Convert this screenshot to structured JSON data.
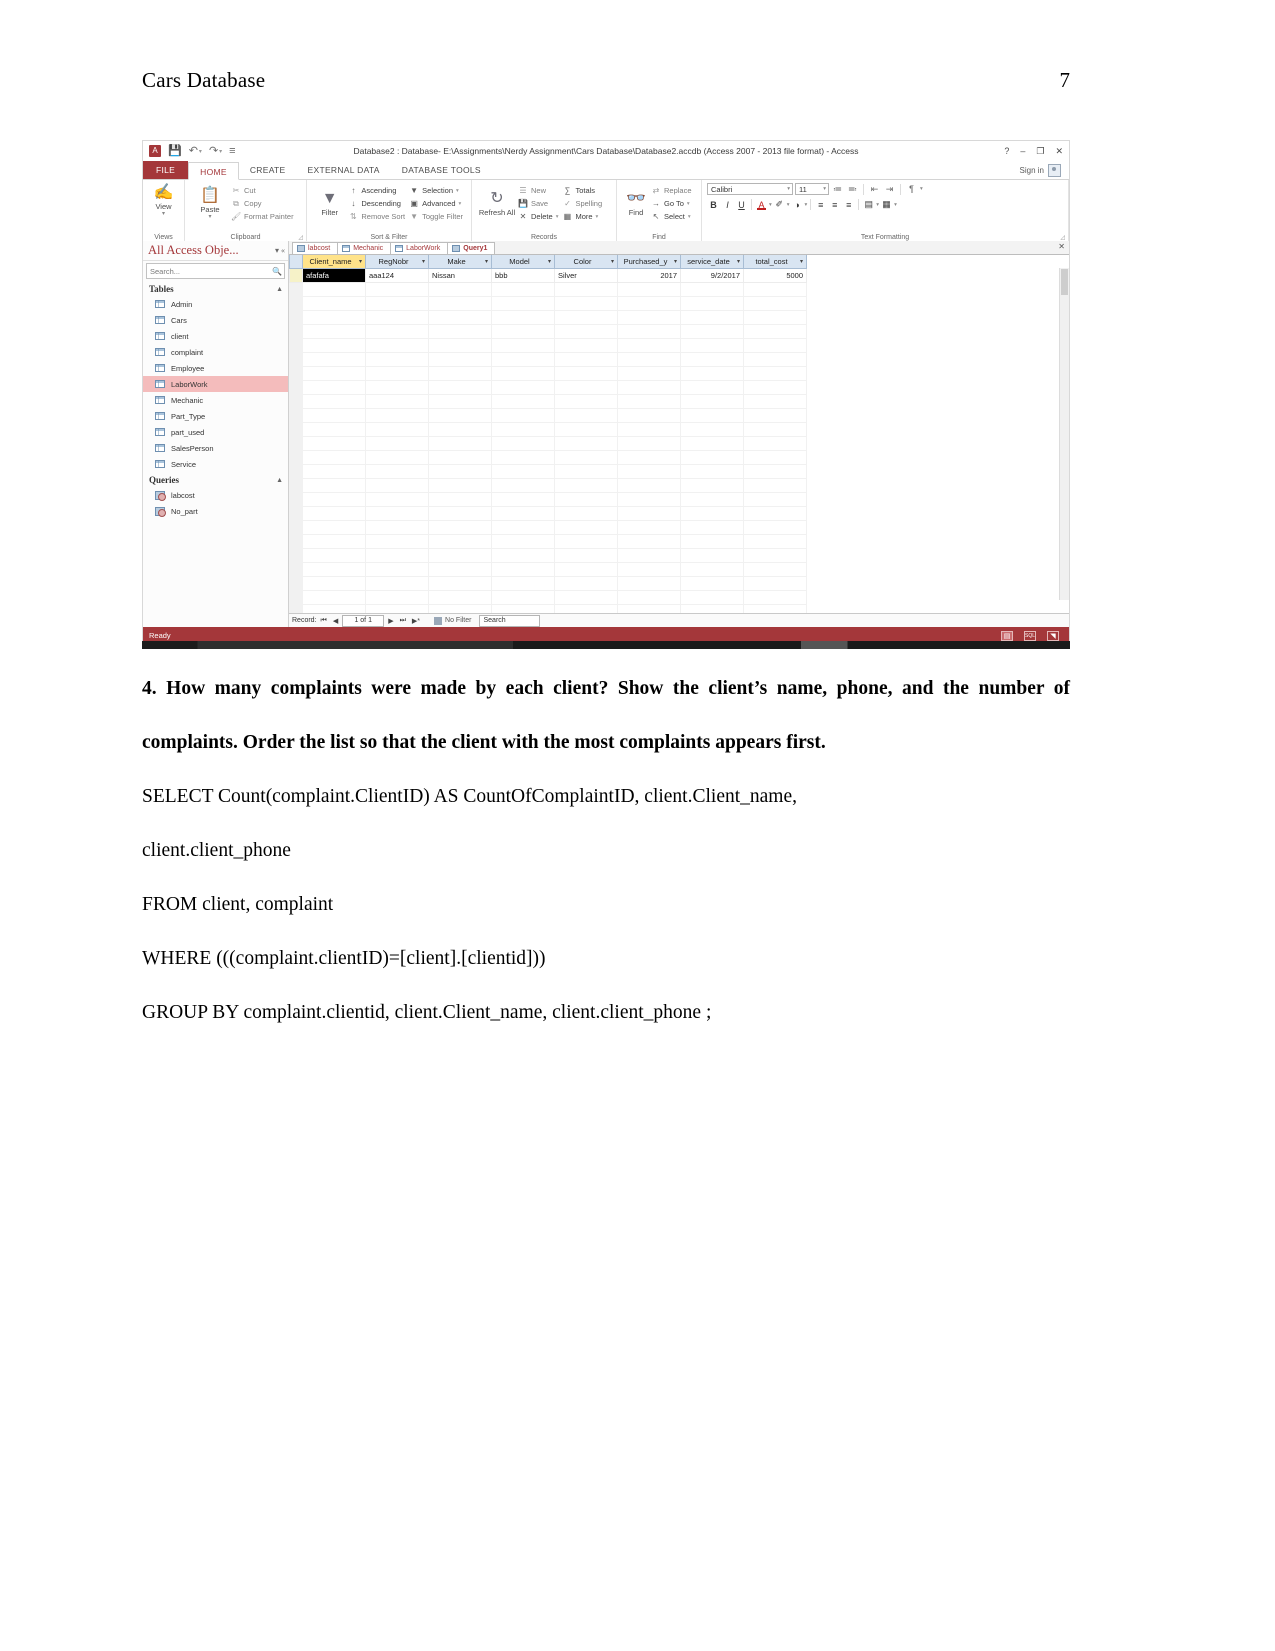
{
  "document": {
    "running_head": "Cars Database",
    "page_number": "7",
    "question": "4. How many complaints were made by each client? Show the client’s name, phone, and the number of complaints. Order the list so that the client with the most complaints appears first.",
    "sql_lines": [
      "SELECT Count(complaint.ClientID) AS CountOfComplaintID, client.Client_name,",
      "client.client_phone",
      "FROM client, complaint",
      "WHERE (((complaint.clientID)=[client].[clientid]))",
      "GROUP BY complaint.clientid, client.Client_name, client.client_phone ;"
    ]
  },
  "screenshot": {
    "titlebar": {
      "app_badge": "A",
      "window_title": "Database2 : Database- E:\\Assignments\\Nerdy Assignment\\Cars Database\\Database2.accdb (Access 2007 - 2013 file format) - Access",
      "qat": [
        {
          "name": "save-icon",
          "glyph": "💾"
        },
        {
          "name": "undo-icon",
          "glyph": "↶"
        },
        {
          "name": "redo-icon",
          "glyph": "↷"
        },
        {
          "name": "customize-qat-icon",
          "glyph": "≡"
        }
      ],
      "controls": [
        {
          "name": "help-button",
          "glyph": "?"
        },
        {
          "name": "minimize-button",
          "glyph": "–"
        },
        {
          "name": "restore-button",
          "glyph": "❐"
        },
        {
          "name": "close-button",
          "glyph": "✕"
        }
      ]
    },
    "ribbon": {
      "file_tab": "FILE",
      "tabs": [
        {
          "label": "HOME",
          "active": true
        },
        {
          "label": "CREATE",
          "active": false
        },
        {
          "label": "EXTERNAL DATA",
          "active": false
        },
        {
          "label": "DATABASE TOOLS",
          "active": false
        }
      ],
      "sign_in": "Sign in",
      "groups": [
        {
          "label": "Views"
        },
        {
          "label": "Clipboard"
        },
        {
          "label": "Sort & Filter"
        },
        {
          "label": "Records"
        },
        {
          "label": "Find"
        },
        {
          "label": "Text Formatting"
        }
      ],
      "views": {
        "big_button": "View"
      },
      "clipboard": {
        "paste": "Paste",
        "items": [
          {
            "label": "Cut",
            "icon": "scissors-icon",
            "glyph": "✂"
          },
          {
            "label": "Copy",
            "icon": "copy-icon",
            "glyph": "⧉"
          },
          {
            "label": "Format Painter",
            "icon": "format-painter-icon",
            "glyph": "🖌"
          }
        ]
      },
      "sort_filter": {
        "filter": "Filter",
        "col1": [
          {
            "label": "Ascending",
            "icon": "sort-ascending-icon",
            "glyph": "↑"
          },
          {
            "label": "Descending",
            "icon": "sort-descending-icon",
            "glyph": "↓"
          },
          {
            "label": "Remove Sort",
            "icon": "remove-sort-icon",
            "glyph": "⇅"
          }
        ],
        "col2": [
          {
            "label": "Selection",
            "icon": "selection-icon",
            "glyph": "▼",
            "caret": "▾"
          },
          {
            "label": "Advanced",
            "icon": "advanced-filter-icon",
            "glyph": "▣",
            "caret": "▾"
          },
          {
            "label": "Toggle Filter",
            "icon": "toggle-filter-icon",
            "glyph": "▼",
            "caret": ""
          }
        ]
      },
      "records": {
        "refresh_all": "Refresh All",
        "items": [
          {
            "label": "New",
            "icon": "new-record-icon",
            "glyph": "☰"
          },
          {
            "label": "Save",
            "icon": "save-record-icon",
            "glyph": "💾"
          },
          {
            "label": "Delete",
            "icon": "delete-record-icon",
            "glyph": "✕",
            "caret": "▾"
          }
        ],
        "items2": [
          {
            "label": "Totals",
            "icon": "totals-icon",
            "glyph": "∑"
          },
          {
            "label": "Spelling",
            "icon": "spelling-icon",
            "glyph": "✓"
          },
          {
            "label": "More",
            "icon": "more-icon",
            "glyph": "▦",
            "caret": "▾"
          }
        ]
      },
      "find": {
        "find_button": "Find",
        "items": [
          {
            "label": "Replace",
            "icon": "replace-icon",
            "glyph": "⇄"
          },
          {
            "label": "Go To",
            "icon": "go-to-icon",
            "glyph": "→",
            "caret": "▾"
          },
          {
            "label": "Select",
            "icon": "select-icon",
            "glyph": "↖",
            "caret": "▾"
          }
        ]
      },
      "text_formatting": {
        "font_name": "Calibri",
        "font_size": "11",
        "bold": "B",
        "italic": "I",
        "underline": "U",
        "font_color": "A",
        "highlight": "✐",
        "fill_color": "◑",
        "bullets": "≔",
        "numbering": "≕",
        "dec_indent": "⇤",
        "inc_indent": "⇥",
        "text_direction": "¶",
        "align_left": "≡",
        "align_center": "≡",
        "align_right": "≡",
        "datasheet_format": "▤",
        "gridlines": "▦"
      }
    },
    "nav_pane": {
      "title": "All Access Obje...",
      "search_placeholder": "Search...",
      "groups": [
        {
          "label": "Tables",
          "items": [
            {
              "label": "Admin",
              "selected": false
            },
            {
              "label": "Cars",
              "selected": false
            },
            {
              "label": "client",
              "selected": false
            },
            {
              "label": "complaint",
              "selected": false
            },
            {
              "label": "Employee",
              "selected": false
            },
            {
              "label": "LaborWork",
              "selected": true
            },
            {
              "label": "Mechanic",
              "selected": false
            },
            {
              "label": "Part_Type",
              "selected": false
            },
            {
              "label": "part_used",
              "selected": false
            },
            {
              "label": "SalesPerson",
              "selected": false
            },
            {
              "label": "Service",
              "selected": false
            }
          ]
        },
        {
          "label": "Queries",
          "items": [
            {
              "label": "labcost",
              "selected": false
            },
            {
              "label": "No_part",
              "selected": false
            }
          ]
        }
      ]
    },
    "document_tabs": [
      {
        "label": "labcost",
        "type": "query",
        "active": false
      },
      {
        "label": "Mechanic",
        "type": "table",
        "active": false
      },
      {
        "label": "LaborWork",
        "type": "table",
        "active": false
      },
      {
        "label": "Query1",
        "type": "query",
        "active": true
      }
    ],
    "datasheet": {
      "columns": [
        {
          "label": "Client_name",
          "highlighted": true
        },
        {
          "label": "RegNobr",
          "highlighted": false
        },
        {
          "label": "Make",
          "highlighted": false
        },
        {
          "label": "Model",
          "highlighted": false
        },
        {
          "label": "Color",
          "highlighted": false
        },
        {
          "label": "Purchased_y",
          "highlighted": false
        },
        {
          "label": "service_date",
          "highlighted": false
        },
        {
          "label": "total_cost",
          "highlighted": false
        }
      ],
      "rows": [
        [
          "afafafa",
          "aaa124",
          "Nissan",
          "bbb",
          "Silver",
          "2017",
          "9/2/2017",
          "5000"
        ]
      ]
    },
    "record_nav": {
      "label": "Record:",
      "first": "⏮",
      "prev": "◀",
      "position": "1 of 1",
      "next": "▶",
      "last": "⏭",
      "new": "▶*",
      "filter_status": "No Filter",
      "search_placeholder": "Search"
    },
    "status_bar": {
      "text": "Ready",
      "view_buttons": [
        {
          "name": "datasheet-view-button",
          "glyph": "▤",
          "selected": true
        },
        {
          "name": "sql-view-button",
          "glyph": "SQL",
          "selected": false
        },
        {
          "name": "design-view-button",
          "glyph": "◥",
          "selected": false
        }
      ]
    }
  }
}
